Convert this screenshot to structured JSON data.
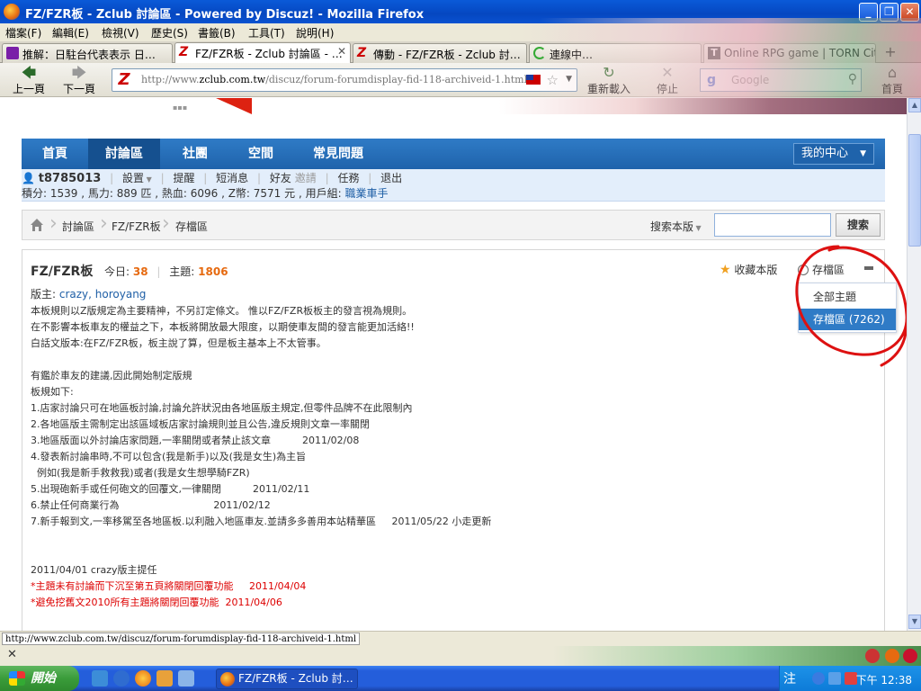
{
  "window": {
    "title": "FZ/FZR板 - Zclub 討論區 - Powered by Discuz! - Mozilla Firefox",
    "min": "_",
    "max": "❐",
    "close": "✕"
  },
  "menu": [
    "檔案(F)",
    "編輯(E)",
    "檢視(V)",
    "歷史(S)",
    "書籤(B)",
    "工具(T)",
    "說明(H)"
  ],
  "tabs": [
    {
      "label": "推解：日駐台代表表示 日…"
    },
    {
      "label": "FZ/FZR板 - Zclub 討論區 - …"
    },
    {
      "label": "傳動 - FZ/FZR板 - Zclub 討…"
    },
    {
      "label": "連線中…"
    },
    {
      "label": "Online RPG game | TORN Cit…"
    }
  ],
  "tab_new": "+",
  "tab_close": "✕",
  "nav": {
    "back": "上一頁",
    "forward": "下一頁",
    "reload": "重新載入",
    "stop": "停止",
    "home": "首頁",
    "url_prefix": "http://www.",
    "url_domain": "zclub.com.tw",
    "url_path": "/discuz/forum-forumdisplay-fid-118-archiveid-1.html",
    "search_engine": "Google"
  },
  "site_nav": {
    "items": [
      "首頁",
      "討論區",
      "社團",
      "空間",
      "常見問題"
    ],
    "active": "討論區",
    "my_center": "我的中心"
  },
  "user": {
    "name": "t8785013",
    "links": [
      "設置",
      "提醒",
      "短消息",
      "好友",
      "邀請",
      "任務",
      "退出"
    ],
    "stats_text": "積分: 1539 , 馬力: 889 匹 , 熱血: 6096 , Z幣: 7571 元 , 用戶組: ",
    "group": "職業車手"
  },
  "breadcrumb": {
    "items": [
      "討論區",
      "FZ/FZR板",
      "存檔區"
    ],
    "scope_label": "搜索本版",
    "search_placeholder": "",
    "search_button": "搜索"
  },
  "forum": {
    "title": "FZ/FZR板",
    "today_label": "今日:",
    "today_count": "38",
    "topics_label": "主題:",
    "topics_count": "1806",
    "mods_label": "版主:",
    "mods": "crazy, horoyang",
    "fav_label": "收藏本版",
    "archive_label": "存檔區",
    "dropdown": {
      "options": [
        "全部主題",
        "存檔區 (7262)"
      ],
      "selected": 1
    },
    "rules": [
      {
        "text": "本板規則以Z版規定為主要精神，不另訂定條文。 惟以FZ/FZR板板主的發言視為規則。",
        "red": false
      },
      {
        "text": "在不影響本板車友的權益之下，本板將開放最大限度，以期使車友間的發言能更加活絡!!",
        "red": false
      },
      {
        "text": "白話文版本:在FZ/FZR板，板主說了算，但是板主基本上不太管事。",
        "red": false
      },
      {
        "text": "",
        "red": false
      },
      {
        "text": "有鑑於車友的建議,因此開始制定版規",
        "red": false
      },
      {
        "text": "板規如下:",
        "red": false
      },
      {
        "text": "1.店家討論只可在地區板討論,討論允許狀況由各地區版主規定,但零件品牌不在此限制內",
        "red": false
      },
      {
        "text": "2.各地區版主需制定出該區域板店家討論規則並且公告,違反規則文章一率關閉",
        "red": false
      },
      {
        "text": "3.地區版面以外討論店家問題,一率關閉或者禁止該文章          2011/02/08",
        "red": false
      },
      {
        "text": "4.發表新討論串時,不可以包含(我是新手)以及(我是女生)為主旨",
        "red": false
      },
      {
        "text": "  例如(我是新手救救我)或者(我是女生想學騎FZR)",
        "red": false
      },
      {
        "text": "5.出現砲新手或任何砲文的回覆文,一律關閉          2011/02/11",
        "red": false
      },
      {
        "text": "6.禁止任何商業行為                              2011/02/12",
        "red": false
      },
      {
        "text": "7.新手報到文,一率移駕至各地區板.以利融入地區車友.並請多多善用本站精華區     2011/05/22 小走更新",
        "red": false
      },
      {
        "text": "",
        "red": false
      },
      {
        "text": "",
        "red": false
      },
      {
        "text": "2011/04/01 crazy版主提任",
        "red": false
      },
      {
        "text": "*主題未有討論而下沉至第五頁將關閉回覆功能     2011/04/04",
        "red": true
      },
      {
        "text": "*避免挖舊文2010所有主題將關閉回覆功能  2011/04/06",
        "red": true
      }
    ]
  },
  "status": {
    "url": "http://www.zclub.com.tw/discuz/forum-forumdisplay-fid-118-archiveid-1.html"
  },
  "taskbar": {
    "start": "開始",
    "window": "FZ/FZR板 - Zclub 討…",
    "ime": "注",
    "clock": "下午 12:38"
  },
  "colors": {
    "site_nav": "#2f7bc6",
    "accent_orange": "#e66a10",
    "link": "#1f5fa6",
    "annotation": "#dd1111"
  }
}
